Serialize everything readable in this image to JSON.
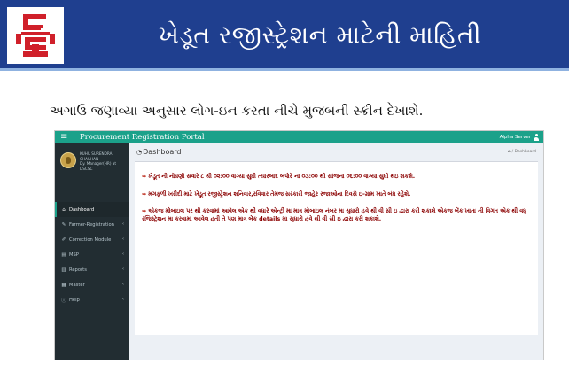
{
  "slide": {
    "title": "ખેડૂત રજીસ્ટ્રેશન માટેની માહિતી",
    "lead": "અગાઉ જણાવ્યા અનુસાર લોગ-ઇન કરતા નીચે મુજબની સ્ક્રીન દેખાશે.",
    "logo_icon": "gujarat-state-civil-supplies-logo"
  },
  "portal": {
    "title": "Procurement Registration Portal",
    "user": "Alpha Server",
    "profile": {
      "lines": [
        "KUHU SURENDRA",
        "CHAUHAN",
        "Dy. Manager(HR) at",
        "DSCSC"
      ]
    },
    "nav": [
      {
        "label": "Dashboard",
        "icon": "dashboard-icon",
        "glyph": "⌂",
        "active": true,
        "arrow": false
      },
      {
        "label": "Farmer-Registration",
        "icon": "pencil-icon",
        "glyph": "✎",
        "active": false,
        "arrow": true
      },
      {
        "label": "Correction Module",
        "icon": "edit-icon",
        "glyph": "✐",
        "active": false,
        "arrow": true
      },
      {
        "label": "MSP",
        "icon": "document-icon",
        "glyph": "▤",
        "active": false,
        "arrow": true
      },
      {
        "label": "Reports",
        "icon": "bar-chart-icon",
        "glyph": "▥",
        "active": false,
        "arrow": true
      },
      {
        "label": "Master",
        "icon": "grid-icon",
        "glyph": "▦",
        "active": false,
        "arrow": true
      },
      {
        "label": "Help",
        "icon": "info-icon",
        "glyph": "ⓘ",
        "active": false,
        "arrow": true
      }
    ],
    "content": {
      "heading": "Dashboard",
      "breadcrumb": "/ Dashboard",
      "notices": [
        "ખેડૂત ની નોંધણી સવારે ૮ થી ૦૨:૦૦ વાગ્યા સુધી ત્યારબાદ બપોરે ના ૦૩:૦૦ થી સાંજના ૦૬:૦૦ વાગ્યા સુધી થઇ શકશે.",
        "મગફળી ખરીદી માટે ખેડૂત રજીસ્ટ્રેશન શનિવાર,રવિવાર તેમજ સરકારી જાહેર રજાઓના દિવસે ઇ-ગ્રામ ખાતે બંધ રહેશે.",
        "એકજ મોબાઇલ પર થી કરવામાં આવેલ એક થી વધારે એન્ટ્રી મા માત્ર મોબાઇલ નંબર મા સુધારો હવે થી વી સી ઇ દ્વારા કરી શકાશે એકજ બેંક ખાતા ની વિગત એક થી વધુ રજિસ્ટ્રેશન મા કરવામાં આવેલ હતી તે પણ માત્ર બેંક details મા સુધારો હવે થી વી સી ઇ દ્વારા કરી શકાશે."
      ]
    }
  },
  "colors": {
    "header_blue": "#1f3f8f",
    "portal_green": "#1ba18a",
    "sidebar_dark": "#222d32",
    "notice_red": "#8b0000"
  }
}
